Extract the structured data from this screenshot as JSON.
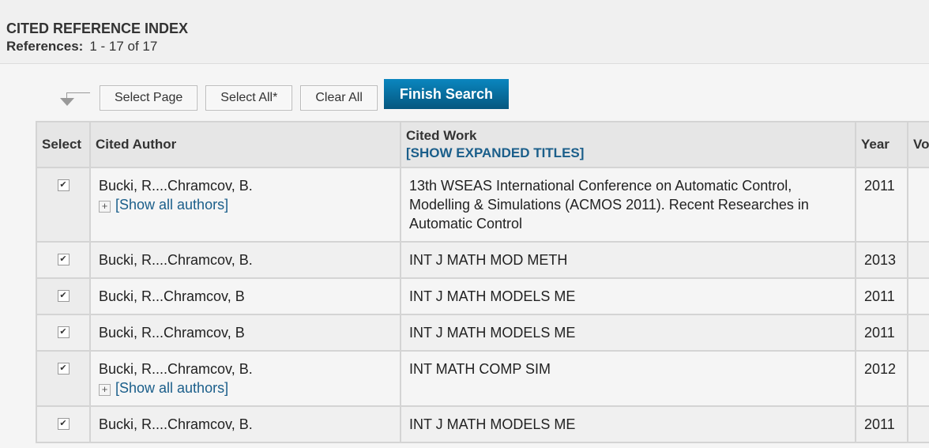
{
  "header": {
    "title": "CITED REFERENCE INDEX",
    "refs_label": "References:",
    "refs_value": "1 - 17 of 17"
  },
  "toolbar": {
    "select_page": "Select Page",
    "select_all": "Select All*",
    "clear_all": "Clear All",
    "finish": "Finish Search"
  },
  "table": {
    "columns": {
      "select": "Select",
      "author": "Cited Author",
      "work": "Cited Work",
      "expand": "[SHOW EXPANDED TITLES]",
      "year": "Year",
      "vol": "Vo"
    },
    "show_all": "[Show all authors]",
    "rows": [
      {
        "checked": true,
        "author": "Bucki, R....Chramcov, B.",
        "show_all": true,
        "work": "13th WSEAS International Conference on Automatic Control, Modelling & Simulations (ACMOS 2011). Recent Researches in Automatic Control",
        "year": "2011"
      },
      {
        "checked": true,
        "author": "Bucki, R....Chramcov, B.",
        "show_all": false,
        "work": "INT J MATH MOD METH",
        "year": "2013"
      },
      {
        "checked": true,
        "author": "Bucki, R...Chramcov, B",
        "show_all": false,
        "work": "INT J MATH MODELS ME",
        "year": "2011"
      },
      {
        "checked": true,
        "author": "Bucki, R...Chramcov, B",
        "show_all": false,
        "work": "INT J MATH MODELS ME",
        "year": "2011"
      },
      {
        "checked": true,
        "author": "Bucki, R....Chramcov, B.",
        "show_all": true,
        "work": "INT MATH COMP SIM",
        "year": "2012"
      },
      {
        "checked": true,
        "author": "Bucki, R....Chramcov, B.",
        "show_all": false,
        "work": "INT J MATH MODELS ME",
        "year": "2011"
      }
    ]
  }
}
